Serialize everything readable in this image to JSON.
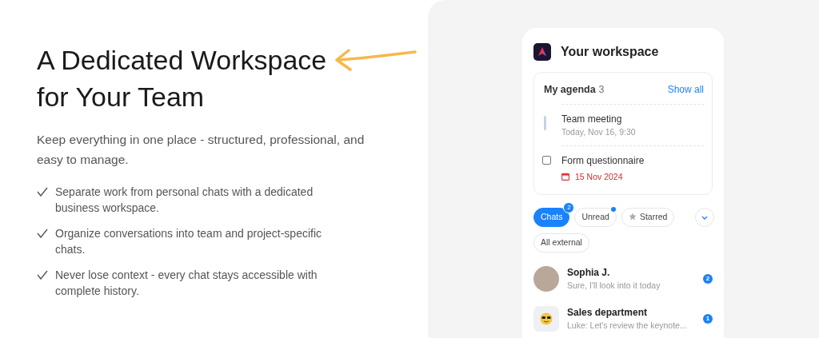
{
  "hero": {
    "title_lines": [
      "A Dedicated Workspace",
      "for Your Team"
    ],
    "subtitle": "Keep everything in one place - structured, professional, and easy to manage.",
    "features": [
      "Separate work from personal chats with a dedicated business workspace.",
      "Organize conversations into team and project-specific chats.",
      "Never lose context - every chat stays accessible with complete history."
    ]
  },
  "workspace": {
    "title": "Your workspace",
    "agenda": {
      "title": "My agenda",
      "count": "3",
      "link": "Show all",
      "items": [
        {
          "kind": "event",
          "title": "Team meeting",
          "subtitle": "Today, Nov 16, 9:30"
        },
        {
          "kind": "task",
          "title": "Form questionnaire",
          "subtitle": "15 Nov 2024",
          "checked": false
        }
      ]
    },
    "filters": [
      {
        "label": "Chats",
        "selected": true,
        "badge": "2",
        "dot": false,
        "star": false
      },
      {
        "label": "Unread",
        "selected": false,
        "dot": true,
        "star": false
      },
      {
        "label": "Starred",
        "selected": false,
        "dot": false,
        "star": true
      },
      {
        "label": "All external",
        "selected": false,
        "dot": false,
        "star": false
      }
    ],
    "chats": [
      {
        "kind": "photo",
        "name": "Sophia J.",
        "preview": "Sure, I'll look into it today",
        "unread": "2"
      },
      {
        "kind": "emoji",
        "name": "Sales department",
        "preview": "Luke: Let's review the keynote...",
        "unread": "1"
      }
    ]
  }
}
